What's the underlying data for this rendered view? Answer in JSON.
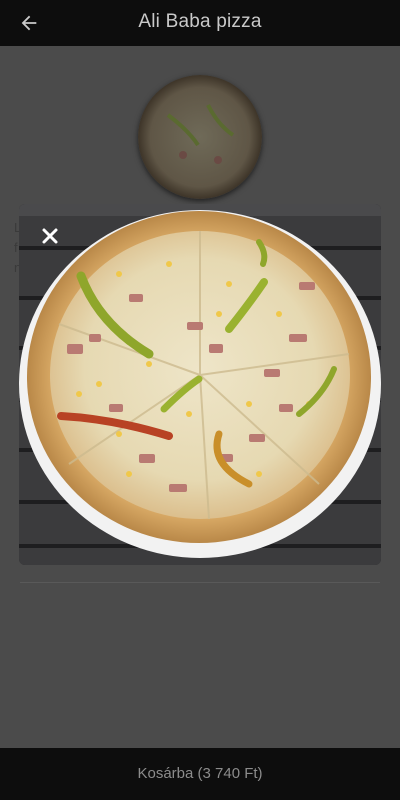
{
  "header": {
    "title": "Ali Baba pizza",
    "back_icon": "arrow-left-icon"
  },
  "background_text": {
    "line1": "L",
    "line2": "f",
    "line3": "n"
  },
  "modal": {
    "close_icon": "close-icon",
    "image_alt": "Pizza"
  },
  "footer": {
    "cart_label": "Kosárba (3 740 Ft)"
  },
  "colors": {
    "bar": "#0d0d0d",
    "overlay": "#4b4b4b",
    "text": "#c9c9c9"
  }
}
